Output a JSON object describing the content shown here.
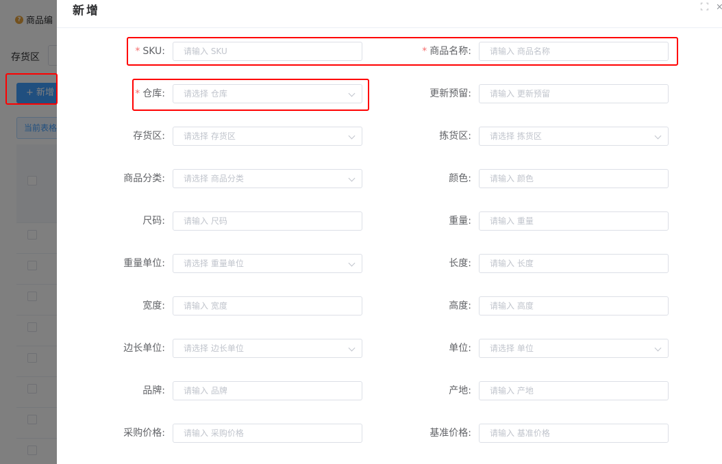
{
  "background": {
    "tip": "商品编",
    "filter_label": "存货区",
    "add_button": "+ 新增",
    "table_tab": "当前表格"
  },
  "drawer": {
    "title": "新增",
    "fields": [
      {
        "label": "SKU:",
        "required": true,
        "type": "input",
        "placeholder": "请输入 SKU"
      },
      {
        "label": "商品名称:",
        "required": true,
        "type": "input",
        "placeholder": "请输入 商品名称"
      },
      {
        "label": "仓库:",
        "required": true,
        "type": "select",
        "placeholder": "请选择 仓库"
      },
      {
        "label": "更新预留:",
        "required": false,
        "type": "input",
        "placeholder": "请输入 更新预留"
      },
      {
        "label": "存货区:",
        "required": false,
        "type": "select",
        "placeholder": "请选择 存货区"
      },
      {
        "label": "拣货区:",
        "required": false,
        "type": "select",
        "placeholder": "请选择 拣货区"
      },
      {
        "label": "商品分类:",
        "required": false,
        "type": "select",
        "placeholder": "请选择 商品分类"
      },
      {
        "label": "颜色:",
        "required": false,
        "type": "input",
        "placeholder": "请输入 颜色"
      },
      {
        "label": "尺码:",
        "required": false,
        "type": "input",
        "placeholder": "请输入 尺码"
      },
      {
        "label": "重量:",
        "required": false,
        "type": "input",
        "placeholder": "请输入 重量"
      },
      {
        "label": "重量单位:",
        "required": false,
        "type": "select",
        "placeholder": "请选择 重量单位"
      },
      {
        "label": "长度:",
        "required": false,
        "type": "input",
        "placeholder": "请输入 长度"
      },
      {
        "label": "宽度:",
        "required": false,
        "type": "input",
        "placeholder": "请输入 宽度"
      },
      {
        "label": "高度:",
        "required": false,
        "type": "input",
        "placeholder": "请输入 高度"
      },
      {
        "label": "边长单位:",
        "required": false,
        "type": "select",
        "placeholder": "请选择 边长单位"
      },
      {
        "label": "单位:",
        "required": false,
        "type": "select",
        "placeholder": "请选择 单位"
      },
      {
        "label": "品牌:",
        "required": false,
        "type": "input",
        "placeholder": "请输入 品牌"
      },
      {
        "label": "产地:",
        "required": false,
        "type": "input",
        "placeholder": "请输入 产地"
      },
      {
        "label": "采购价格:",
        "required": false,
        "type": "input",
        "placeholder": "请输入 采购价格"
      },
      {
        "label": "基准价格:",
        "required": false,
        "type": "input",
        "placeholder": "请输入 基准价格"
      }
    ]
  },
  "colors": {
    "primary": "#409eff",
    "required_star": "#f56c6c",
    "highlight": "#ff0000"
  }
}
